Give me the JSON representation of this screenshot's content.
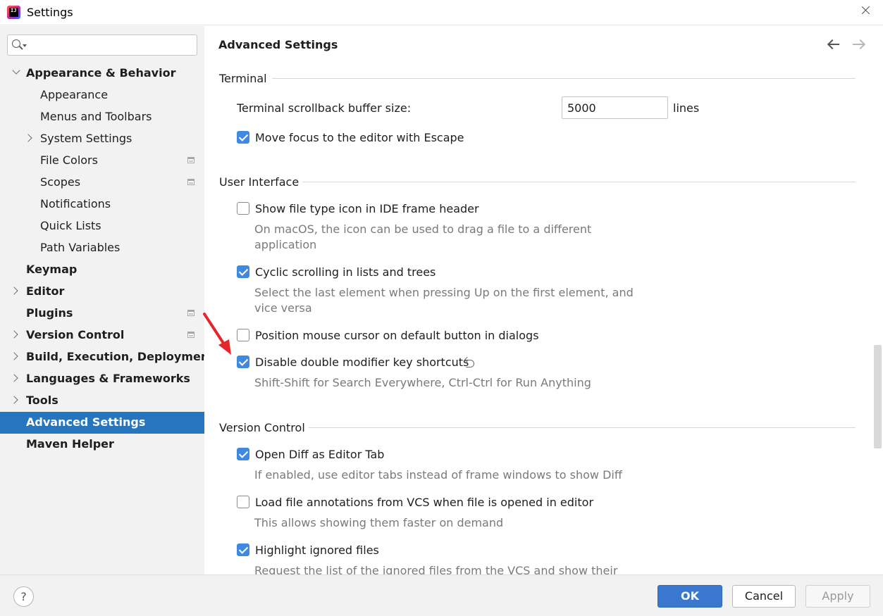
{
  "window": {
    "title": "Settings",
    "logo_text": "IJ"
  },
  "sidebar": {
    "search": {
      "value": "",
      "placeholder": ""
    },
    "items": [
      {
        "label": "Appearance & Behavior",
        "expanded": true
      },
      {
        "label": "Appearance"
      },
      {
        "label": "Menus and Toolbars"
      },
      {
        "label": "System Settings"
      },
      {
        "label": "File Colors"
      },
      {
        "label": "Scopes"
      },
      {
        "label": "Notifications"
      },
      {
        "label": "Quick Lists"
      },
      {
        "label": "Path Variables"
      },
      {
        "label": "Keymap"
      },
      {
        "label": "Editor"
      },
      {
        "label": "Plugins"
      },
      {
        "label": "Version Control"
      },
      {
        "label": "Build, Execution, Deployment"
      },
      {
        "label": "Languages & Frameworks"
      },
      {
        "label": "Tools"
      },
      {
        "label": "Advanced Settings",
        "selected": true
      },
      {
        "label": "Maven Helper"
      }
    ]
  },
  "main": {
    "title": "Advanced Settings",
    "sections": {
      "terminal": {
        "title": "Terminal",
        "scrollback_label": "Terminal scrollback buffer size:",
        "scrollback_value": "5000",
        "scrollback_unit": "lines",
        "move_focus_label": "Move focus to the editor with Escape",
        "move_focus_checked": true
      },
      "ui": {
        "title": "User Interface",
        "show_icon_label": "Show file type icon in IDE frame header",
        "show_icon_checked": false,
        "show_icon_desc": "On macOS, the icon can be used to drag a file to a different application",
        "cyclic_label": "Cyclic scrolling in lists and trees",
        "cyclic_checked": true,
        "cyclic_desc": "Select the last element when pressing Up on the first element, and vice versa",
        "mouse_label": "Position mouse cursor on default button in dialogs",
        "mouse_checked": false,
        "double_mod_label": "Disable double modifier key shortcuts",
        "double_mod_checked": true,
        "double_mod_desc": "Shift-Shift for Search Everywhere, Ctrl-Ctrl for Run Anything"
      },
      "vcs": {
        "title": "Version Control",
        "diff_label": "Open Diff as Editor Tab",
        "diff_checked": true,
        "diff_desc": "If enabled, use editor tabs instead of frame windows to show Diff",
        "annotations_label": "Load file annotations from VCS when file is opened in editor",
        "annotations_checked": false,
        "annotations_desc": "This allows showing them faster on demand",
        "ignored_label": "Highlight ignored files",
        "ignored_checked": true,
        "ignored_desc": "Request the list of the ignored files from the VCS and show their"
      }
    }
  },
  "footer": {
    "help_label": "?",
    "ok_label": "OK",
    "cancel_label": "Cancel",
    "apply_label": "Apply"
  },
  "colors": {
    "accent": "#2675bf",
    "checkbox_checked": "#3f8ae0",
    "annotation_arrow": "#e5262b"
  },
  "icons": [
    "app-logo-icon",
    "close-icon",
    "search-icon",
    "chevron-right-icon",
    "chevron-down-icon",
    "project-level-icon",
    "back-arrow-icon",
    "forward-arrow-icon",
    "reset-icon",
    "help-icon"
  ]
}
